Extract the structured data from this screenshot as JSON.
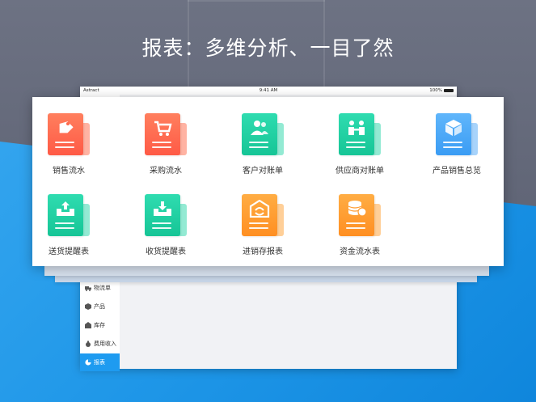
{
  "headline": "报表：多维分析、一目了然",
  "status_bar": {
    "carrier": "Astract",
    "time": "9:41 AM",
    "battery": "100%"
  },
  "sidebar": {
    "items": [
      {
        "label": "物流单",
        "icon": "truck-icon"
      },
      {
        "label": "产品",
        "icon": "cube-icon"
      },
      {
        "label": "库存",
        "icon": "warehouse-icon"
      },
      {
        "label": "费用收入",
        "icon": "money-bag-icon"
      },
      {
        "label": "报表",
        "icon": "pie-chart-icon",
        "active": true
      }
    ]
  },
  "reports": [
    {
      "label": "销售流水",
      "icon": "price-tag-icon",
      "color": "#ff6a4d",
      "back": "#ffb3a3"
    },
    {
      "label": "采购流水",
      "icon": "shopping-cart-icon",
      "color": "#ff6a4d",
      "back": "#ffb3a3"
    },
    {
      "label": "客户对账单",
      "icon": "users-icon",
      "color": "#1fd1a3",
      "back": "#93ead3"
    },
    {
      "label": "供应商对账单",
      "icon": "handshake-icon",
      "color": "#1fd1a3",
      "back": "#93ead3"
    },
    {
      "label": "产品销售总览",
      "icon": "box-icon",
      "color": "#4aa8f8",
      "back": "#a7d3fb"
    },
    {
      "label": "送货提醒表",
      "icon": "inbox-upload-icon",
      "color": "#1fd1a3",
      "back": "#93ead3"
    },
    {
      "label": "收货提醒表",
      "icon": "inbox-download-icon",
      "color": "#1fd1a3",
      "back": "#93ead3"
    },
    {
      "label": "进销存报表",
      "icon": "warehouse-cycle-icon",
      "color": "#ff9b2f",
      "back": "#ffcf98"
    },
    {
      "label": "资金流水表",
      "icon": "coins-icon",
      "color": "#ff9b2f",
      "back": "#ffcf98"
    }
  ]
}
